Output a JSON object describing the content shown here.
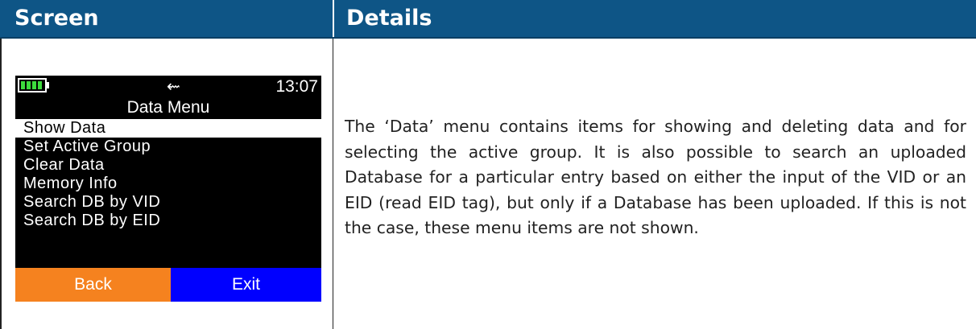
{
  "table": {
    "headers": {
      "screen": "Screen",
      "details": "Details"
    }
  },
  "device": {
    "status": {
      "usb_icon": "⇜",
      "time": "13:07",
      "battery_icon": "battery-full-icon"
    },
    "title": "Data Menu",
    "menu_items": [
      {
        "label": "Show Data",
        "selected": true
      },
      {
        "label": "Set Active Group",
        "selected": false
      },
      {
        "label": "Clear Data",
        "selected": false
      },
      {
        "label": "Memory Info",
        "selected": false
      },
      {
        "label": "Search DB by VID",
        "selected": false
      },
      {
        "label": "Search DB by EID",
        "selected": false
      }
    ],
    "softkeys": {
      "left": "Back",
      "right": "Exit"
    },
    "colors": {
      "left_softkey": "#f5821f",
      "right_softkey": "#0000ff",
      "battery": "#3ddc3d"
    }
  },
  "details": {
    "text": "The ‘Data’ menu contains items for showing and deleting data and for selecting the active group. It is also possible to search an uploaded Database for a particular entry based on either the input of the VID or an EID (read EID tag), but only if a Database has been uploaded. If this is not the case, these menu items are not shown."
  },
  "colors": {
    "header_bg": "#0e5586",
    "header_text": "#ffffff"
  }
}
